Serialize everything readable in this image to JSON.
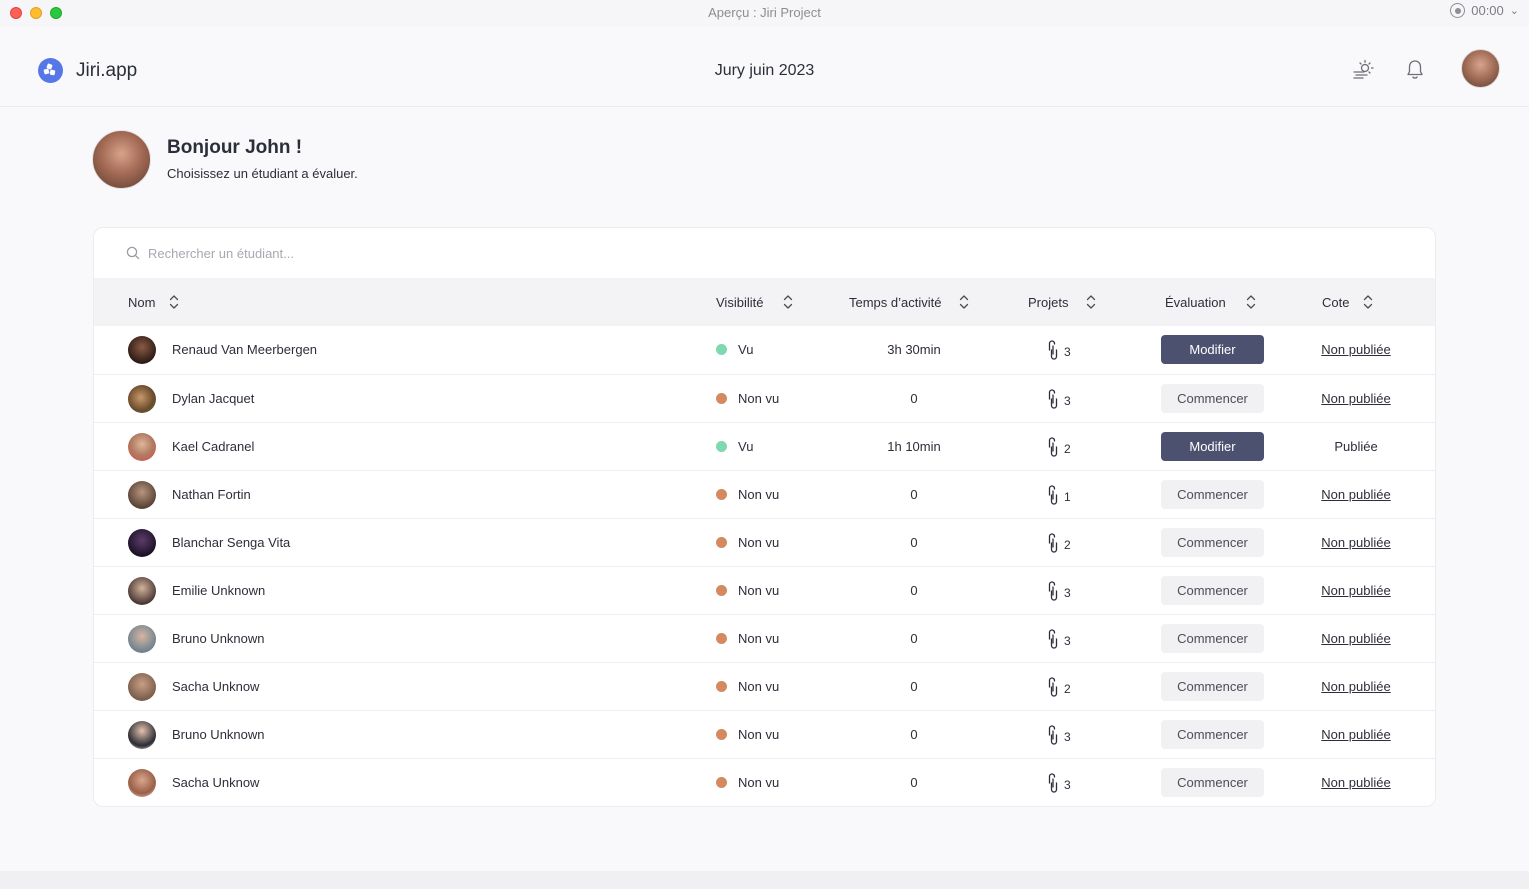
{
  "window": {
    "title": "Aperçu : Jiri Project",
    "timer": "00:00"
  },
  "header": {
    "brand": "Jiri.app",
    "jury_title": "Jury juin 2023"
  },
  "greeting": {
    "title": "Bonjour John !",
    "subtitle": "Choisissez un étudiant a évaluer."
  },
  "search": {
    "placeholder": "Rechercher un étudiant..."
  },
  "table": {
    "columns": {
      "nom": "Nom",
      "visibilite": "Visibilité",
      "temps": "Temps d’activité",
      "projets": "Projets",
      "evaluation": "Évaluation",
      "cote": "Cote"
    },
    "rows": [
      {
        "name": "Renaud Van Meerbergen",
        "visibility": "Vu",
        "time": "3h 30min",
        "projects": "3",
        "action": "Modifier",
        "cote": "Non publiée"
      },
      {
        "name": "Dylan Jacquet",
        "visibility": "Non vu",
        "time": "0",
        "projects": "3",
        "action": "Commencer",
        "cote": "Non publiée"
      },
      {
        "name": "Kael Cadranel",
        "visibility": "Vu",
        "time": "1h 10min",
        "projects": "2",
        "action": "Modifier",
        "cote": "Publiée"
      },
      {
        "name": "Nathan Fortin",
        "visibility": "Non vu",
        "time": "0",
        "projects": "1",
        "action": "Commencer",
        "cote": "Non publiée"
      },
      {
        "name": "Blanchar Senga Vita",
        "visibility": "Non vu",
        "time": "0",
        "projects": "2",
        "action": "Commencer",
        "cote": "Non publiée"
      },
      {
        "name": "Emilie Unknown",
        "visibility": "Non vu",
        "time": "0",
        "projects": "3",
        "action": "Commencer",
        "cote": "Non publiée"
      },
      {
        "name": "Bruno Unknown",
        "visibility": "Non vu",
        "time": "0",
        "projects": "3",
        "action": "Commencer",
        "cote": "Non publiée"
      },
      {
        "name": "Sacha Unknow",
        "visibility": "Non vu",
        "time": "0",
        "projects": "2",
        "action": "Commencer",
        "cote": "Non publiée"
      },
      {
        "name": "Bruno Unknown",
        "visibility": "Non vu",
        "time": "0",
        "projects": "3",
        "action": "Commencer",
        "cote": "Non publiée"
      },
      {
        "name": "Sacha Unknow",
        "visibility": "Non vu",
        "time": "0",
        "projects": "3",
        "action": "Commencer",
        "cote": "Non publiée"
      }
    ]
  },
  "colors": {
    "seen": "#7ed8b0",
    "unseen": "#d48a5e",
    "primary_button": "#4d5170",
    "brand": "#5577e8"
  },
  "icons": [
    "theme-toggle-icon",
    "bell-icon",
    "search-icon",
    "sort-icon",
    "link-icon",
    "record-icon",
    "chevron-down-icon"
  ]
}
